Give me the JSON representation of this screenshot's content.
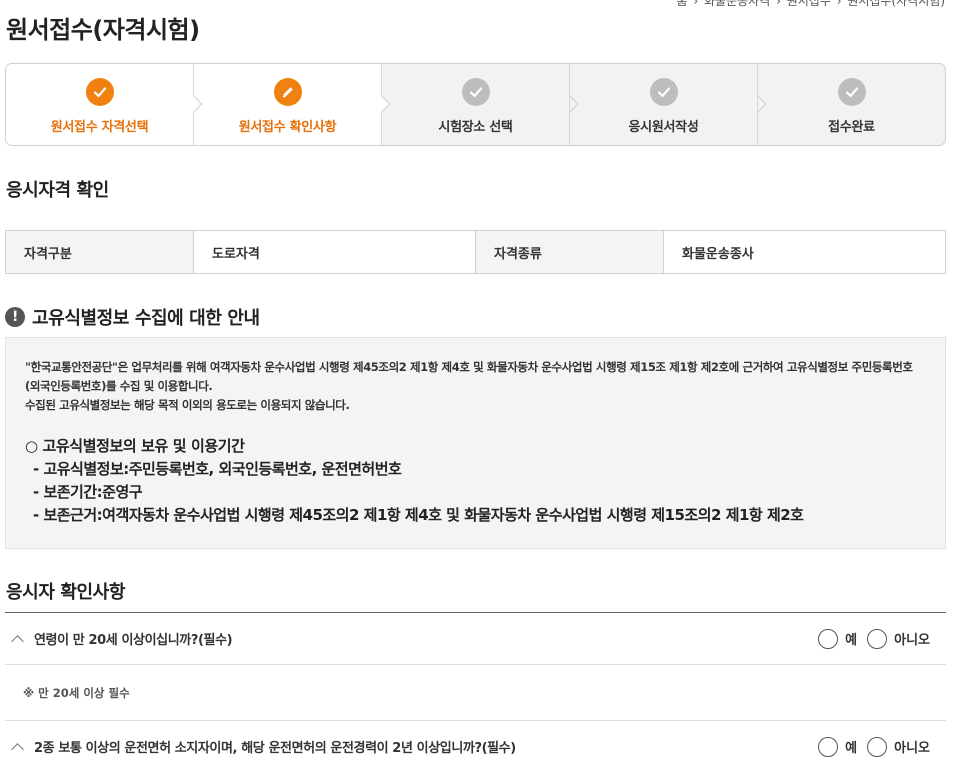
{
  "breadcrumb": [
    "홈",
    "화물운송자격",
    "원서접수",
    "원서접수(자격시험)"
  ],
  "page_title": "원서접수(자격시험)",
  "steps": [
    {
      "label": "원서접수 자격선택",
      "icon": "check-icon",
      "state": "done"
    },
    {
      "label": "원서접수 확인사항",
      "icon": "pencil-icon",
      "state": "current"
    },
    {
      "label": "시험장소 선택",
      "icon": "check-icon",
      "state": "pending"
    },
    {
      "label": "응시원서작성",
      "icon": "check-icon",
      "state": "pending"
    },
    {
      "label": "접수완료",
      "icon": "check-icon",
      "state": "pending"
    }
  ],
  "qualification": {
    "title": "응시자격 확인",
    "category_label": "자격구분",
    "category_value": "도로자격",
    "type_label": "자격종류",
    "type_value": "화물운송종사"
  },
  "notice": {
    "title": "고유식별정보 수집에 대한 안내",
    "para1": "\"한국교통안전공단\"은 업무처리를 위해 여객자동차 운수사업법 시행령 제45조의2 제1항 제4호 및 화물자동차 운수사업법 시행령 제15조 제1항 제2호에 근거하여 고유식별정보 주민등록번호(외국인등록번호)를 수집 및 이용합니다.",
    "para2": "수집된 고유식별정보는 해당 목적 이외의 용도로는 이용되지 않습니다.",
    "sub_title": "○ 고유식별정보의 보유 및 이용기간",
    "items": [
      "- 고유식별정보:주민등록번호, 외국인등록번호, 운전면허번호",
      "- 보존기간:준영구",
      "- 보존근거:여객자동차 운수사업법 시행령 제45조의2 제1항 제4호 및 화물자동차 운수사업법 시행령 제15조의2 제1항 제2호"
    ]
  },
  "confirm": {
    "title": "응시자 확인사항",
    "questions": [
      {
        "text": "연령이 만 20세 이상이십니까?(필수)",
        "yes": "예",
        "no": "아니오",
        "note": "※ 만 20세 이상 필수"
      },
      {
        "text": "2종 보통 이상의 운전면허 소지자이며, 해당 운전면허의 운전경력이 2년 이상입니까?(필수)",
        "yes": "예",
        "no": "아니오"
      }
    ]
  },
  "colors": {
    "accent": "#f08010",
    "inactive": "#bdbdbd"
  }
}
